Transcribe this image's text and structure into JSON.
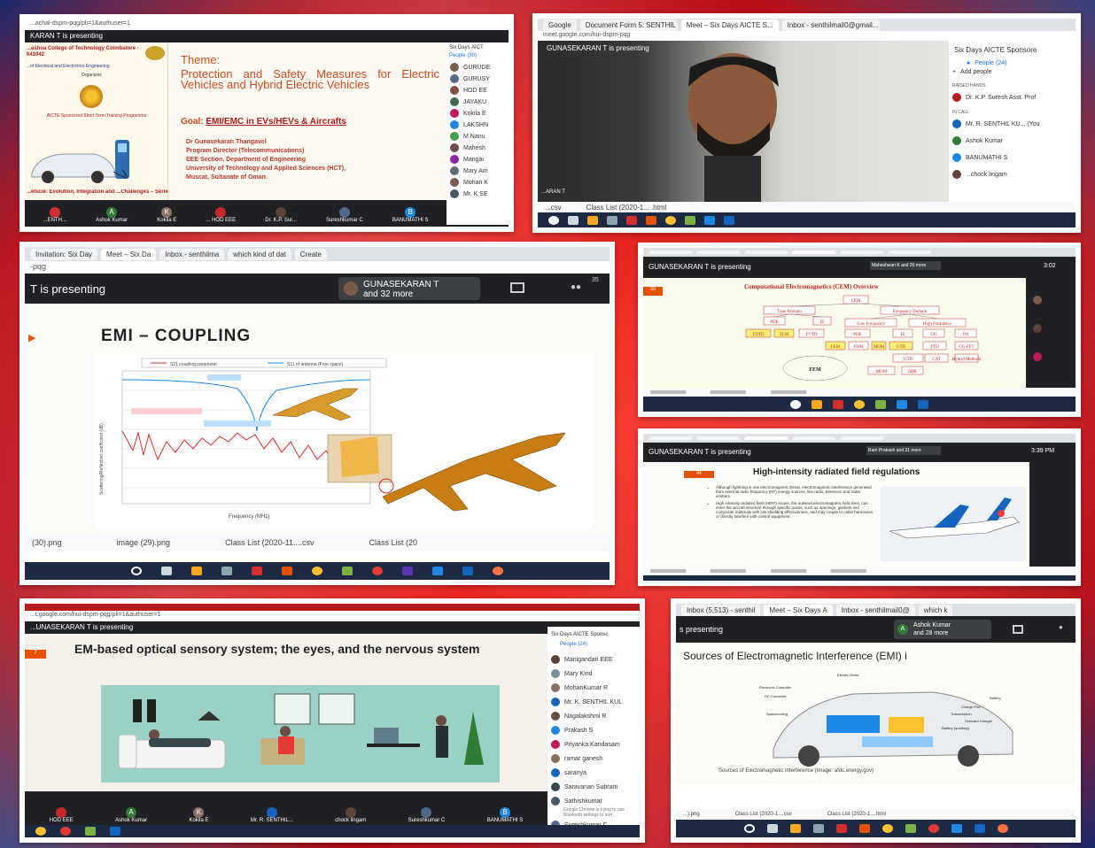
{
  "p1": {
    "url": "...achal-dspm-pqg/pli=1&authuser=1",
    "presenting": "KARAN T is presenting",
    "college": "...ashoa College of Technology Coimbatore - 641042",
    "dept": "...of Electrical and Electronics Engineering",
    "organises": "Organizes",
    "program": "AICTE Sponsored Short Term Training Programme",
    "theme_label": "Theme:",
    "theme": "Protection and Safety Measures for Electric Vehicles and Hybrid Electric Vehicles",
    "goal_label": "Goal:",
    "goal": "EMI/EMC in EVs/HEVs & Aircrafts",
    "speaker": [
      "Dr Gunasekaran Thangavel",
      "Program Director (Telecommunications)",
      "EEE Section, Department of Engineering",
      "University of Technology and Applied Sciences (HCT),",
      "Muscat, Sultanate of Oman."
    ],
    "footer": "...ehicle: Evolution, Integration and ...Challenges – Series:02",
    "side_title": "Six Days AICT",
    "side_people": "People (30)",
    "side_names": [
      "GURUDE",
      "GURUSY",
      "HOD EE",
      "JAYAKU",
      "Kokila E",
      "LAKSHN",
      "M Nanu",
      "Mahesh",
      "Mangai",
      "Mary Am",
      "Mohan K",
      "Mr. K SE"
    ],
    "tiles": [
      "...ENTH...",
      "Ashok Kumar",
      "Kokila E",
      "... HOD EEE",
      "Dr. K.P. Sur...",
      "Sureshkumar C",
      "BANUMATHI S"
    ]
  },
  "p2": {
    "tabs": [
      "Google",
      "Document Form 5: SENTHIL",
      "Meet – Six Days AICTE S...",
      "Inbox - senthilmail0@gmail..."
    ],
    "url": "meet.google.com/hui-dspm-pqg",
    "presenting": "GUNASEKARAN T is presenting",
    "corner_name": "...ARAN T",
    "side_title": "Six Days AICTE Sponsore",
    "people": "People (24)",
    "add_people": "Add people",
    "raised_hands": "RAISED HANDS",
    "raised_name": "Dr. K.P. Suresh Asst. Prof",
    "in_call": "IN CALL",
    "call_names": [
      "Mr. R. SENTHIL KU... (You",
      "Ashok Kumar",
      "BANUMATHI S",
      "...chock lingam"
    ],
    "downloads": [
      "...csv",
      "Class List (2020-1... .html"
    ]
  },
  "p3": {
    "tabs": [
      "Invitation: Six Day",
      "Meet – Six Da",
      "Inbox - senthilma",
      "which kind of dat",
      "Create"
    ],
    "url": "-pqg",
    "presenting": "T is presenting",
    "presenter": "GUNASEKARAN T",
    "more": "and 32 more",
    "count": "35",
    "slide_title": "EMI – COUPLING",
    "legend": [
      "S21 coupling parameter",
      "S11 of antenna (Free space)"
    ],
    "xlabel": "Frequency (MHz)",
    "ylabel": "Scattering/Reflection coefficient (dB)",
    "downloads": [
      "(30).png",
      "image (29).png",
      "Class List (2020-11....csv",
      "Class List (20"
    ]
  },
  "p4": {
    "presenting": "GUNASEKARAN T is presenting",
    "presenter": "Maheshwari K and 26 more",
    "time": "3:02",
    "slide_no": "30",
    "slide_title": "Computational Electromagnetics (CEM) Overview",
    "boxes": [
      "CEM",
      "Time Domain",
      "Frequency Domain",
      "PDE",
      "IE",
      "Low Frequency",
      "High Frequency",
      "FDTD",
      "TLM",
      "FVTD",
      "PDE",
      "IE",
      "GO",
      "PO",
      "FEM",
      "FDM",
      "MOM",
      "GTD",
      "PTD",
      "CG-FFT",
      "UTD",
      "CAT",
      "Hybrid Methods",
      "FEM",
      "MOM",
      "SBR"
    ]
  },
  "p5": {
    "presenting": "GUNASEKARAN T is presenting",
    "presenter": "Ram Prakash and 31 more",
    "time": "3:39 PM",
    "slide_no": "44",
    "slide_title": "High-intensity radiated field regulations",
    "bullets": [
      "Although lightning is one electromagnetic threat, electromagnetic interference generated from external radio frequency (RF) energy sources, like radio, television and radar emitters.",
      "High intensity radiated field (HIRF) issues, the outward electromagnetic field lines, can enter the aircraft structure through specific points, such as openings, gaskets and composite materials with low shielding effectiveness, and may couple to cable harnesses or directly interfere with control equipment."
    ]
  },
  "p6": {
    "url": "...t.google.com/hui-dspm-pqg/pli=1&authuser=1",
    "presenting": "...UNASEKARAN T is presenting",
    "slide_no": "7",
    "slide_title": "EM-based optical sensory system; the eyes, and the nervous system",
    "side_title": "Six Days AICTE Sponsc",
    "people": "People (24)",
    "names": [
      "Manigandan EEE",
      "Mary Kind",
      "MohanKumar R",
      "Mr. K. SENTHIL KUL",
      "Nagalakshmi R",
      "Prakash S",
      "Priyanka Kandasam",
      "ramar ganesh",
      "saranya",
      "Saravanan Subram",
      "Sathishkumar",
      "Sureshkumar C"
    ],
    "tiles": [
      "HOD EEE",
      "Ashok Kumar",
      "Kokila E",
      "Mr. R. SENTHIL...",
      "chock lingam",
      "Sureshkumar C",
      "BANUMATHI S"
    ],
    "toast": "Google Chrome is trying to use Bluetooth settings to sort"
  },
  "p7": {
    "tabs": [
      "Inbox (5,513) - senthil",
      "Meet – Six Days A",
      "Inbox - senthilmail0@",
      "which k"
    ],
    "presenting": "s presenting",
    "presenter": "Ashok Kumar",
    "more": "and 28 more",
    "slide_title": "Sources of Electromagnetic Interference (EMI) i",
    "labels": [
      "Electric Motor",
      "Electronic Controller",
      "DC Converter",
      "Spacecooling",
      "Charge Port",
      "Transmission",
      "Onboard Charger",
      "Battery (auxiliary)",
      "Battery"
    ],
    "caption": "Sources of Electromagnetic Interference (Image: afdc.energy.gov)",
    "downloads": [
      "...).png",
      "Class List (2020-1....csv",
      "Class List (2020-1....html"
    ]
  }
}
